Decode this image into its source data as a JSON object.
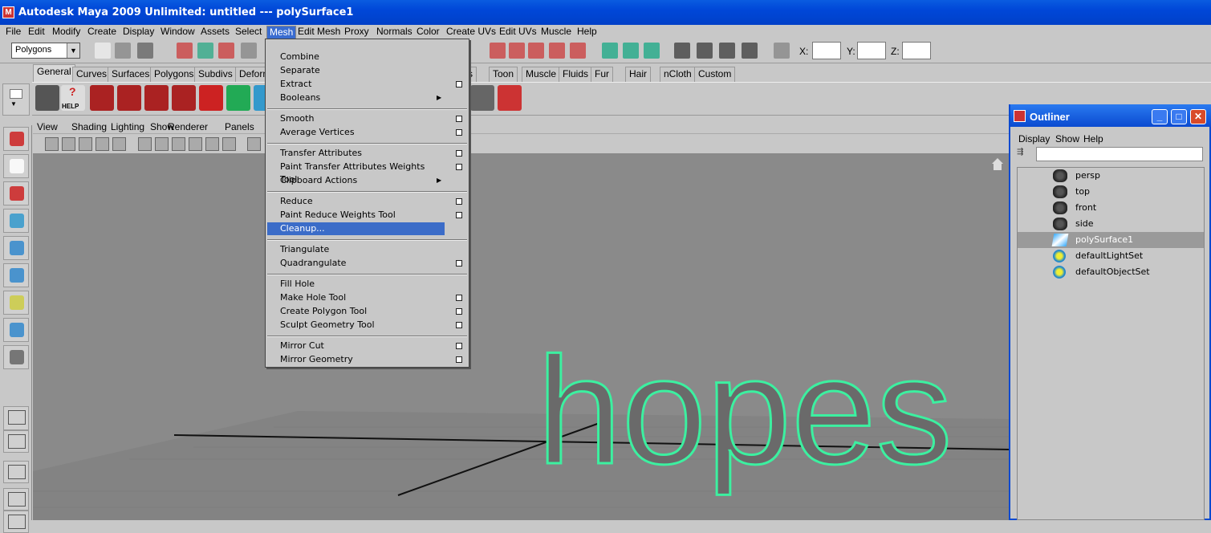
{
  "window": {
    "title": "Autodesk Maya 2009 Unlimited: untitled   ---   polySurface1"
  },
  "menubar": [
    "File",
    "Edit",
    "Modify",
    "Create",
    "Display",
    "Window",
    "Assets",
    "Select",
    "Mesh",
    "Edit Mesh",
    "Proxy",
    "Normals",
    "Color",
    "Create UVs",
    "Edit UVs",
    "Muscle",
    "Help"
  ],
  "status": {
    "mode": "Polygons",
    "x_label": "X:",
    "y_label": "Y:",
    "z_label": "Z:"
  },
  "shelf_tabs": [
    "General",
    "Curves",
    "Surfaces",
    "Polygons",
    "Subdivs",
    "Deform",
    "ects",
    "Toon",
    "Muscle",
    "Fluids",
    "Fur",
    "Hair",
    "nCloth",
    "Custom"
  ],
  "shelf": {
    "help_label": "HELP"
  },
  "viewport_menu": [
    "View",
    "Shading",
    "Lighting",
    "Show",
    "Renderer",
    "Panels"
  ],
  "mesh_menu": {
    "groups": [
      [
        {
          "label": "Combine"
        },
        {
          "label": "Separate"
        },
        {
          "label": "Extract",
          "option": true
        },
        {
          "label": "Booleans",
          "submenu": true
        }
      ],
      [
        {
          "label": "Smooth",
          "option": true
        },
        {
          "label": "Average Vertices",
          "option": true
        }
      ],
      [
        {
          "label": "Transfer Attributes",
          "option": true
        },
        {
          "label": "Paint Transfer Attributes Weights Tool",
          "option": true
        },
        {
          "label": "Clipboard Actions",
          "submenu": true
        }
      ],
      [
        {
          "label": "Reduce",
          "option": true
        },
        {
          "label": "Paint Reduce Weights Tool",
          "option": true
        },
        {
          "label": "Cleanup...",
          "highlighted": true
        }
      ],
      [
        {
          "label": "Triangulate"
        },
        {
          "label": "Quadrangulate",
          "option": true
        }
      ],
      [
        {
          "label": "Fill Hole"
        },
        {
          "label": "Make Hole Tool",
          "option": true
        },
        {
          "label": "Create Polygon Tool",
          "option": true
        },
        {
          "label": "Sculpt Geometry Tool",
          "option": true
        }
      ],
      [
        {
          "label": "Mirror Cut",
          "option": true
        },
        {
          "label": "Mirror Geometry",
          "option": true
        }
      ]
    ]
  },
  "scene": {
    "text": "hopes",
    "accent": "#3cf0a0"
  },
  "outliner": {
    "title": "Outliner",
    "menu": [
      "Display",
      "Show",
      "Help"
    ],
    "items": [
      {
        "label": "persp",
        "icon": "camera-icon"
      },
      {
        "label": "top",
        "icon": "camera-icon"
      },
      {
        "label": "front",
        "icon": "camera-icon"
      },
      {
        "label": "side",
        "icon": "camera-icon"
      },
      {
        "label": "polySurface1",
        "icon": "mesh-icon",
        "selected": true
      },
      {
        "label": "defaultLightSet",
        "icon": "set-icon"
      },
      {
        "label": "defaultObjectSet",
        "icon": "set-icon"
      }
    ]
  }
}
